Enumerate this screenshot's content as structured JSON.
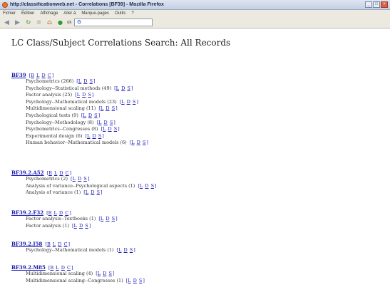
{
  "browser": {
    "title": "http://classificationweb.net - Correlations [BF39] - Mozilla Firefox",
    "window_buttons": [
      "_",
      "□",
      "×"
    ],
    "menu": [
      "Fichier",
      "Édition",
      "Affichage",
      "Aller à",
      "Marque-pages",
      "Outils",
      "?"
    ],
    "url_value": "G",
    "url_placeholder": ""
  },
  "page": {
    "title": "LC Class/Subject Correlations Search: All Records"
  },
  "records": [
    {
      "code": "BF39",
      "links": [
        "B",
        "L",
        "D",
        "C"
      ],
      "subjects": [
        {
          "text": "Psychometrics (266)",
          "links": [
            "L",
            "D",
            "S"
          ]
        },
        {
          "text": "Psychology--Statistical methods (49)",
          "links": [
            "L",
            "D",
            "S"
          ]
        },
        {
          "text": "Factor analysis (25)",
          "links": [
            "L",
            "D",
            "S"
          ]
        },
        {
          "text": "Psychology--Mathematical models (23)",
          "links": [
            "L",
            "D",
            "S"
          ]
        },
        {
          "text": "Multidimensional scaling (11)",
          "links": [
            "L",
            "D",
            "S"
          ]
        },
        {
          "text": "Psychological tests (9)",
          "links": [
            "L",
            "D",
            "S"
          ]
        },
        {
          "text": "Psychology--Methodology (8)",
          "links": [
            "L",
            "D",
            "S"
          ]
        },
        {
          "text": "Psychometrics--Congresses (8)",
          "links": [
            "L",
            "D",
            "S"
          ]
        },
        {
          "text": "Experimental design (6)",
          "links": [
            "L",
            "D",
            "S"
          ]
        },
        {
          "text": "Human behavior--Mathematical models (6)",
          "links": [
            "L",
            "D",
            "S"
          ]
        }
      ]
    },
    {
      "code": "BF39.2.A52",
      "links": [
        "B",
        "L",
        "D",
        "C"
      ],
      "subjects": [
        {
          "text": "Psychometrics (2)",
          "links": [
            "L",
            "D",
            "S"
          ]
        },
        {
          "text": "Analysis of variance--Psychological aspects (1)",
          "links": [
            "L",
            "D",
            "S"
          ]
        },
        {
          "text": "Analysis of variance (1)",
          "links": [
            "L",
            "D",
            "S"
          ]
        }
      ]
    },
    {
      "code": "BF39.2.F32",
      "links": [
        "B",
        "L",
        "D",
        "C"
      ],
      "subjects": [
        {
          "text": "Factor analysis--Textbooks (1)",
          "links": [
            "L",
            "D",
            "S"
          ]
        },
        {
          "text": "Factor analysis (1)",
          "links": [
            "L",
            "D",
            "S"
          ]
        }
      ]
    },
    {
      "code": "BF39.2.I58",
      "links": [
        "B",
        "L",
        "D",
        "C"
      ],
      "subjects": [
        {
          "text": "Psychology--Mathematical models (1)",
          "links": [
            "L",
            "D",
            "S"
          ]
        }
      ]
    },
    {
      "code": "BF39.2.M85",
      "links": [
        "B",
        "L",
        "D",
        "C"
      ],
      "subjects": [
        {
          "text": "Multidimensional scaling (4)",
          "links": [
            "L",
            "D",
            "S"
          ]
        },
        {
          "text": "Multidimensional scaling--Congresses (1)",
          "links": [
            "L",
            "D",
            "S"
          ]
        }
      ]
    }
  ]
}
